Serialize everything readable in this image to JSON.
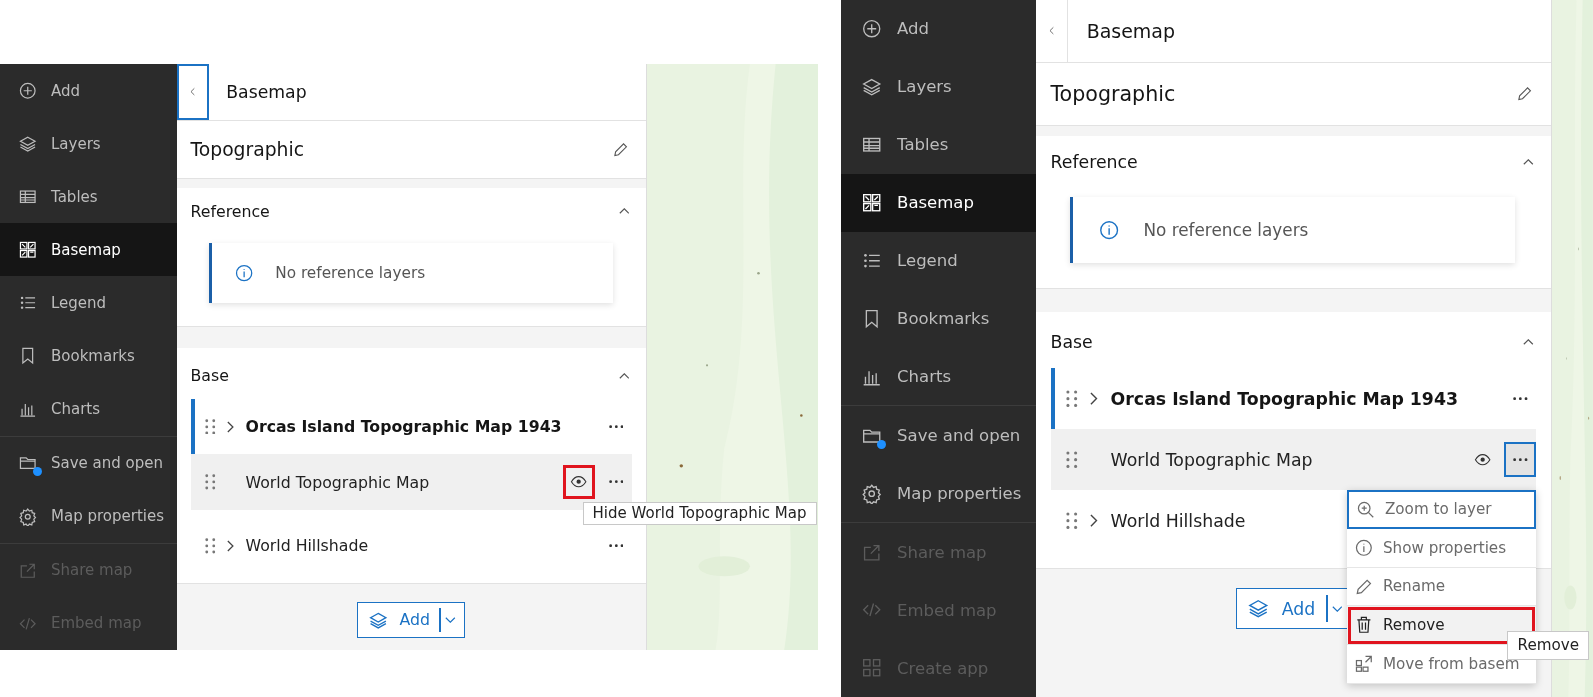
{
  "screens": [
    {
      "nav_groups": [
        [
          {
            "label": "Add",
            "selected": false,
            "disabled": false,
            "badge": false
          },
          {
            "label": "Layers",
            "selected": false,
            "disabled": false,
            "badge": false
          },
          {
            "label": "Tables",
            "selected": false,
            "disabled": false,
            "badge": false
          },
          {
            "label": "Basemap",
            "selected": true,
            "disabled": false,
            "badge": false
          },
          {
            "label": "Legend",
            "selected": false,
            "disabled": false,
            "badge": false
          },
          {
            "label": "Bookmarks",
            "selected": false,
            "disabled": false,
            "badge": false
          },
          {
            "label": "Charts",
            "selected": false,
            "disabled": false,
            "badge": false
          }
        ],
        [
          {
            "label": "Save and open",
            "selected": false,
            "disabled": false,
            "badge": true
          },
          {
            "label": "Map properties",
            "selected": false,
            "disabled": false,
            "badge": false
          }
        ],
        [
          {
            "label": "Share map",
            "selected": false,
            "disabled": true,
            "badge": false
          },
          {
            "label": "Embed map",
            "selected": false,
            "disabled": true,
            "badge": false
          }
        ]
      ],
      "panel": {
        "back_focused": true,
        "title": "Basemap",
        "basemap_name": "Topographic",
        "reference": {
          "title": "Reference",
          "expanded": true,
          "notice": "No reference layers"
        },
        "base": {
          "title": "Base",
          "expanded": true,
          "layers": [
            {
              "name": "Orcas Island Topographic Map 1943",
              "emphasized": true,
              "expandable": true,
              "active": true,
              "hovered": false,
              "menu_open": false
            },
            {
              "name": "World Topographic Map",
              "emphasized": false,
              "expandable": false,
              "active": false,
              "hovered": true,
              "menu_open": false,
              "eye": {
                "annotated": true,
                "tooltip": "Hide World Topographic Map"
              }
            },
            {
              "name": "World Hillshade",
              "emphasized": false,
              "expandable": true,
              "active": false,
              "hovered": false,
              "menu_open": false
            }
          ]
        },
        "add_button": "Add"
      }
    },
    {
      "nav_groups": [
        [
          {
            "label": "Add",
            "selected": false,
            "disabled": false,
            "badge": false
          },
          {
            "label": "Layers",
            "selected": false,
            "disabled": false,
            "badge": false
          },
          {
            "label": "Tables",
            "selected": false,
            "disabled": false,
            "badge": false
          },
          {
            "label": "Basemap",
            "selected": true,
            "disabled": false,
            "badge": false
          },
          {
            "label": "Legend",
            "selected": false,
            "disabled": false,
            "badge": false
          },
          {
            "label": "Bookmarks",
            "selected": false,
            "disabled": false,
            "badge": false
          },
          {
            "label": "Charts",
            "selected": false,
            "disabled": false,
            "badge": false
          }
        ],
        [
          {
            "label": "Save and open",
            "selected": false,
            "disabled": false,
            "badge": true
          },
          {
            "label": "Map properties",
            "selected": false,
            "disabled": false,
            "badge": false
          }
        ],
        [
          {
            "label": "Share map",
            "selected": false,
            "disabled": true,
            "badge": false
          },
          {
            "label": "Embed map",
            "selected": false,
            "disabled": true,
            "badge": false
          },
          {
            "label": "Create app",
            "selected": false,
            "disabled": true,
            "badge": false
          }
        ]
      ],
      "panel": {
        "back_focused": false,
        "title": "Basemap",
        "basemap_name": "Topographic",
        "reference": {
          "title": "Reference",
          "expanded": true,
          "notice": "No reference layers"
        },
        "base": {
          "title": "Base",
          "expanded": true,
          "layers": [
            {
              "name": "Orcas Island Topographic Map 1943",
              "emphasized": true,
              "expandable": true,
              "active": true,
              "hovered": false,
              "menu_open": false
            },
            {
              "name": "World Topographic Map",
              "emphasized": false,
              "expandable": false,
              "active": false,
              "hovered": true,
              "menu_open": true,
              "eye": {
                "annotated": false
              },
              "menu": [
                {
                  "label": "Zoom to layer",
                  "focused": true,
                  "hovered": false,
                  "annotated": false
                },
                {
                  "label": "Show properties",
                  "focused": false,
                  "hovered": false,
                  "annotated": false
                },
                {
                  "label": "Rename",
                  "focused": false,
                  "hovered": false,
                  "annotated": false
                },
                {
                  "label": "Remove",
                  "focused": false,
                  "hovered": true,
                  "annotated": true,
                  "tooltip": "Remove"
                },
                {
                  "label": "Move from basem",
                  "focused": false,
                  "hovered": false,
                  "annotated": false
                }
              ]
            },
            {
              "name": "World Hillshade",
              "emphasized": false,
              "expandable": true,
              "active": false,
              "hovered": false,
              "menu_open": false
            }
          ]
        },
        "add_button": "Add"
      }
    }
  ]
}
